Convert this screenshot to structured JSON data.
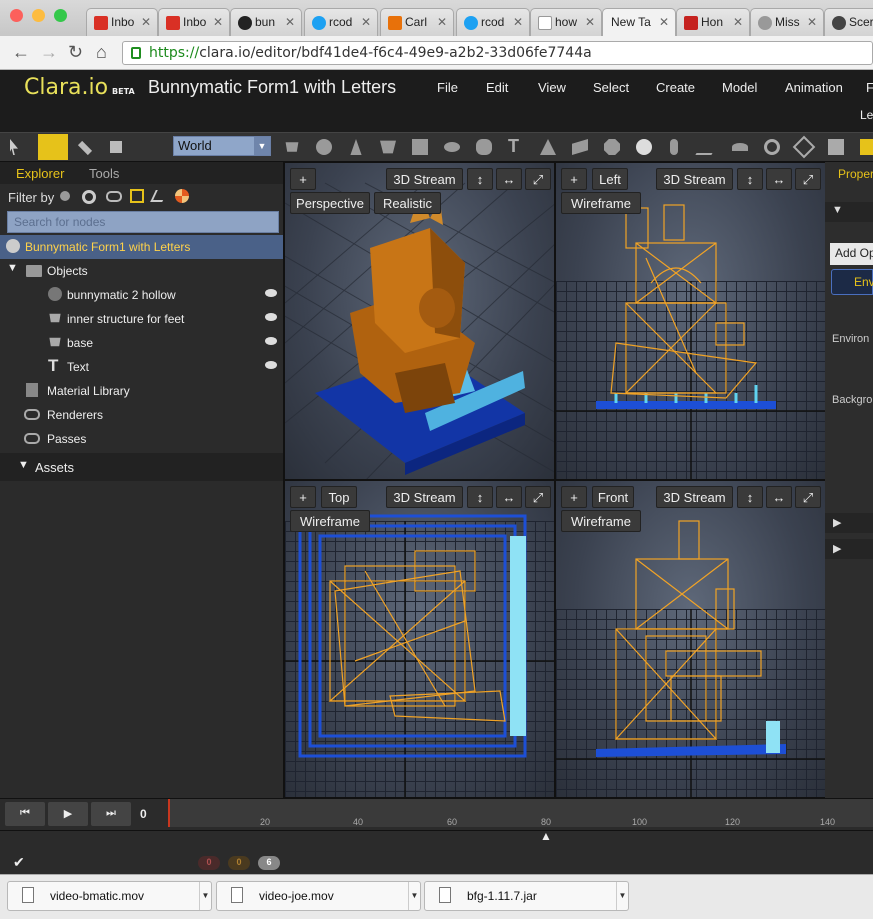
{
  "browser": {
    "tabs": [
      {
        "label": "Inbo",
        "color": "#d93025"
      },
      {
        "label": "Inbo",
        "color": "#d93025"
      },
      {
        "label": "bun",
        "color": "#222222"
      },
      {
        "label": "rcod",
        "color": "#1da1f2"
      },
      {
        "label": "Carl",
        "color": "#e8710a"
      },
      {
        "label": "rcod",
        "color": "#1da1f2"
      },
      {
        "label": "how",
        "color": "#888888"
      },
      {
        "label": "New Ta",
        "color": "#cccccc"
      },
      {
        "label": "Hon",
        "color": "#c5221f"
      },
      {
        "label": "Miss",
        "color": "#777777"
      },
      {
        "label": "Scer",
        "color": "#444444"
      }
    ],
    "url_scheme": "https://",
    "url_rest": "clara.io/editor/bdf41de4-f6c4-49e9-a2b2-33d06fe7744a"
  },
  "app": {
    "logo": "Clara.io",
    "logo_badge": "BETA",
    "title": "Bunnymatic Form1 with Letters",
    "menu": [
      "File",
      "Edit",
      "View",
      "Select",
      "Create",
      "Model",
      "Animation",
      "F"
    ],
    "submenu_fragment": "Le",
    "world_select": "World"
  },
  "left_panel": {
    "tabs": [
      "Explorer",
      "Tools"
    ],
    "filter_label": "Filter by",
    "search_placeholder": "Search for nodes",
    "root_node": "Bunnymatic Form1 with Letters",
    "objects_label": "Objects",
    "objects": [
      "bunnymatic 2 hollow",
      "inner structure for feet",
      "base",
      "Text"
    ],
    "material_library": "Material Library",
    "renderers": "Renderers",
    "passes": "Passes",
    "assets": "Assets"
  },
  "viewports": {
    "plus": "+",
    "stream": "3D Stream",
    "perspective": {
      "mode": "Perspective",
      "render": "Realistic"
    },
    "left": {
      "view": "Left",
      "render": "Wireframe"
    },
    "top": {
      "view": "Top",
      "render": "Wireframe"
    },
    "front": {
      "view": "Front",
      "render": "Wireframe"
    }
  },
  "right_panel": {
    "tab": "Proper",
    "add_op": "Add Op",
    "env_button": "Env",
    "environment_label": "Environ",
    "background_label": "Backgro"
  },
  "timeline": {
    "current_frame": "0",
    "ticks": [
      "20",
      "40",
      "60",
      "80",
      "100",
      "120",
      "140"
    ]
  },
  "status": {
    "badges": [
      "0",
      "0",
      "6"
    ]
  },
  "downloads": [
    "video-bmatic.mov",
    "video-joe.mov",
    "bfg-1.11.7.jar"
  ]
}
